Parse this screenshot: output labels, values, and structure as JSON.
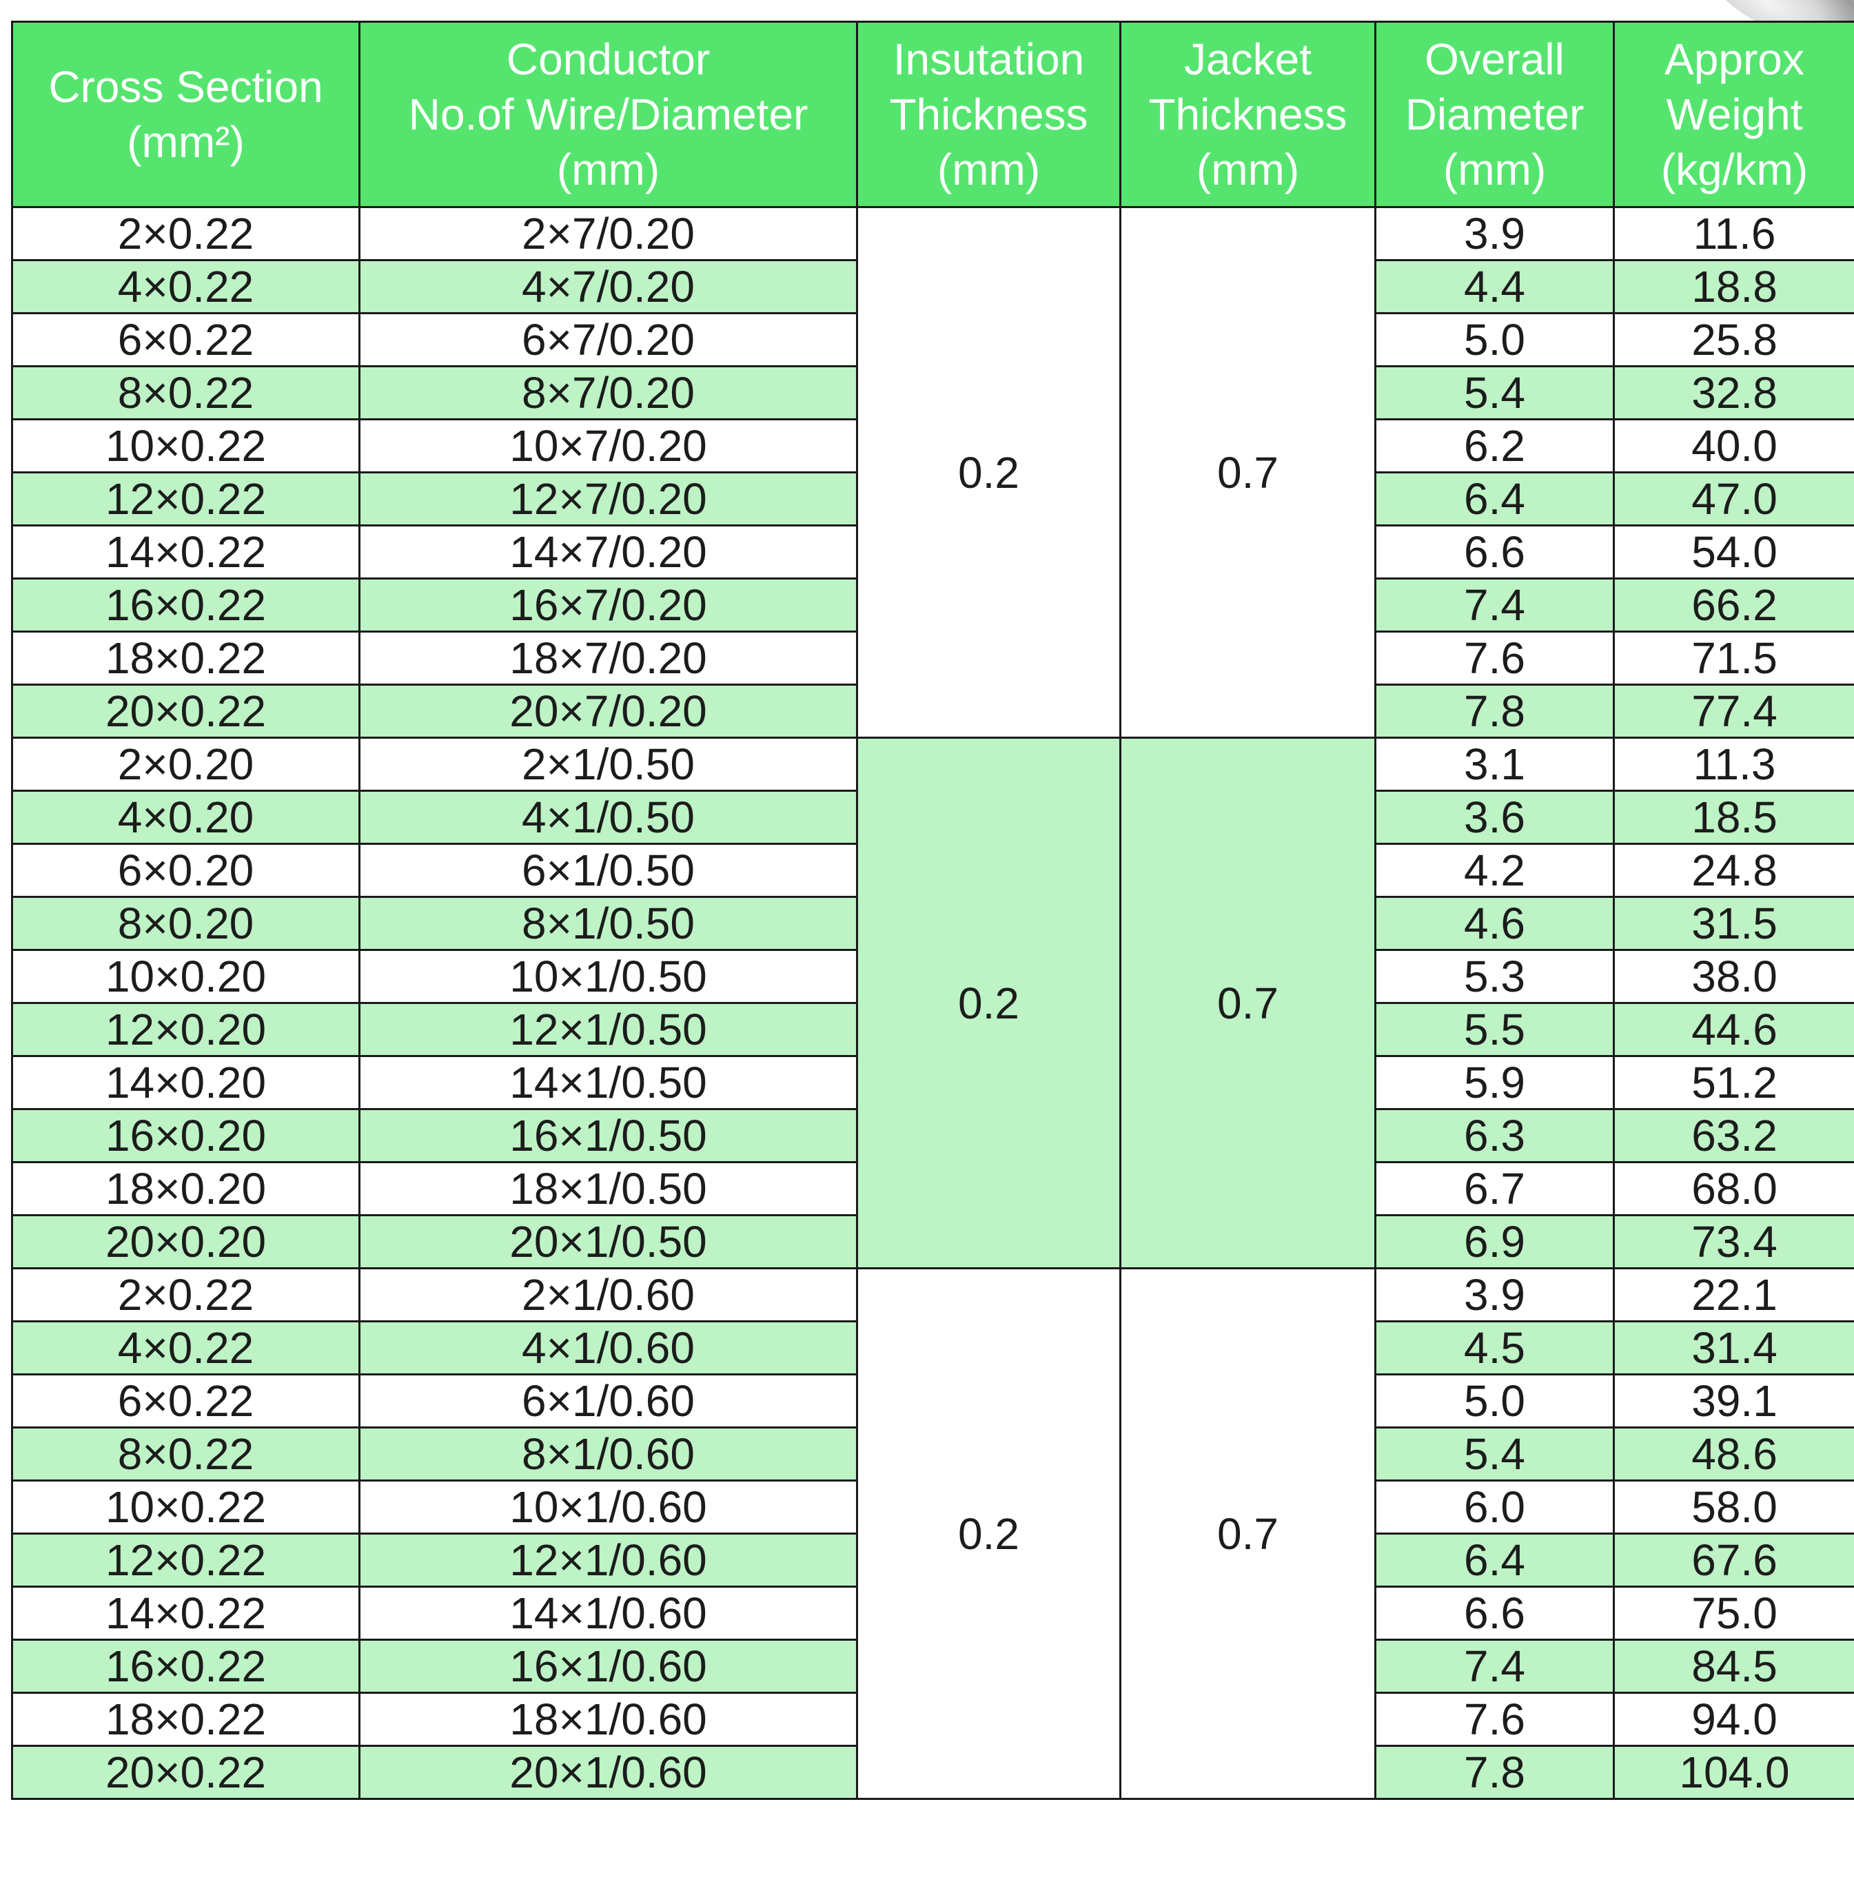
{
  "headers": {
    "cross_section": {
      "line1": "Cross Section",
      "line2": "(mm²)"
    },
    "conductor": {
      "line1": "Conductor",
      "line2": "No.of Wire/Diameter",
      "line3": "(mm)"
    },
    "insulation": {
      "line1": "Insutation",
      "line2": "Thickness",
      "line3": "(mm)"
    },
    "jacket": {
      "line1": "Jacket",
      "line2": "Thickness",
      "line3": "(mm)"
    },
    "overall": {
      "line1": "Overall",
      "line2": "Diameter",
      "line3": "(mm)"
    },
    "weight": {
      "line1": "Approx",
      "line2": "Weight",
      "line3": "(kg/km)"
    }
  },
  "groups": [
    {
      "insulation": "0.2",
      "jacket": "0.7",
      "rows": [
        {
          "cross_section": "2×0.22",
          "conductor": "2×7/0.20",
          "overall_diameter": "3.9",
          "weight": "11.6"
        },
        {
          "cross_section": "4×0.22",
          "conductor": "4×7/0.20",
          "overall_diameter": "4.4",
          "weight": "18.8"
        },
        {
          "cross_section": "6×0.22",
          "conductor": "6×7/0.20",
          "overall_diameter": "5.0",
          "weight": "25.8"
        },
        {
          "cross_section": "8×0.22",
          "conductor": "8×7/0.20",
          "overall_diameter": "5.4",
          "weight": "32.8"
        },
        {
          "cross_section": "10×0.22",
          "conductor": "10×7/0.20",
          "overall_diameter": "6.2",
          "weight": "40.0"
        },
        {
          "cross_section": "12×0.22",
          "conductor": "12×7/0.20",
          "overall_diameter": "6.4",
          "weight": "47.0"
        },
        {
          "cross_section": "14×0.22",
          "conductor": "14×7/0.20",
          "overall_diameter": "6.6",
          "weight": "54.0"
        },
        {
          "cross_section": "16×0.22",
          "conductor": "16×7/0.20",
          "overall_diameter": "7.4",
          "weight": "66.2"
        },
        {
          "cross_section": "18×0.22",
          "conductor": "18×7/0.20",
          "overall_diameter": "7.6",
          "weight": "71.5"
        },
        {
          "cross_section": "20×0.22",
          "conductor": "20×7/0.20",
          "overall_diameter": "7.8",
          "weight": "77.4"
        }
      ]
    },
    {
      "insulation": "0.2",
      "jacket": "0.7",
      "rows": [
        {
          "cross_section": "2×0.20",
          "conductor": "2×1/0.50",
          "overall_diameter": "3.1",
          "weight": "11.3"
        },
        {
          "cross_section": "4×0.20",
          "conductor": "4×1/0.50",
          "overall_diameter": "3.6",
          "weight": "18.5"
        },
        {
          "cross_section": "6×0.20",
          "conductor": "6×1/0.50",
          "overall_diameter": "4.2",
          "weight": "24.8"
        },
        {
          "cross_section": "8×0.20",
          "conductor": "8×1/0.50",
          "overall_diameter": "4.6",
          "weight": "31.5"
        },
        {
          "cross_section": "10×0.20",
          "conductor": "10×1/0.50",
          "overall_diameter": "5.3",
          "weight": "38.0"
        },
        {
          "cross_section": "12×0.20",
          "conductor": "12×1/0.50",
          "overall_diameter": "5.5",
          "weight": "44.6"
        },
        {
          "cross_section": "14×0.20",
          "conductor": "14×1/0.50",
          "overall_diameter": "5.9",
          "weight": "51.2"
        },
        {
          "cross_section": "16×0.20",
          "conductor": "16×1/0.50",
          "overall_diameter": "6.3",
          "weight": "63.2"
        },
        {
          "cross_section": "18×0.20",
          "conductor": "18×1/0.50",
          "overall_diameter": "6.7",
          "weight": "68.0"
        },
        {
          "cross_section": "20×0.20",
          "conductor": "20×1/0.50",
          "overall_diameter": "6.9",
          "weight": "73.4"
        }
      ]
    },
    {
      "insulation": "0.2",
      "jacket": "0.7",
      "rows": [
        {
          "cross_section": "2×0.22",
          "conductor": "2×1/0.60",
          "overall_diameter": "3.9",
          "weight": "22.1"
        },
        {
          "cross_section": "4×0.22",
          "conductor": "4×1/0.60",
          "overall_diameter": "4.5",
          "weight": "31.4"
        },
        {
          "cross_section": "6×0.22",
          "conductor": "6×1/0.60",
          "overall_diameter": "5.0",
          "weight": "39.1"
        },
        {
          "cross_section": "8×0.22",
          "conductor": "8×1/0.60",
          "overall_diameter": "5.4",
          "weight": "48.6"
        },
        {
          "cross_section": "10×0.22",
          "conductor": "10×1/0.60",
          "overall_diameter": "6.0",
          "weight": "58.0"
        },
        {
          "cross_section": "12×0.22",
          "conductor": "12×1/0.60",
          "overall_diameter": "6.4",
          "weight": "67.6"
        },
        {
          "cross_section": "14×0.22",
          "conductor": "14×1/0.60",
          "overall_diameter": "6.6",
          "weight": "75.0"
        },
        {
          "cross_section": "16×0.22",
          "conductor": "16×1/0.60",
          "overall_diameter": "7.4",
          "weight": "84.5"
        },
        {
          "cross_section": "18×0.22",
          "conductor": "18×1/0.60",
          "overall_diameter": "7.6",
          "weight": "94.0"
        },
        {
          "cross_section": "20×0.22",
          "conductor": "20×1/0.60",
          "overall_diameter": "7.8",
          "weight": "104.0"
        }
      ]
    }
  ],
  "colors": {
    "header_green": "#55e56f",
    "row_green": "#bdf3c5",
    "row_white": "#ffffff",
    "border": "#1a1a1a"
  }
}
